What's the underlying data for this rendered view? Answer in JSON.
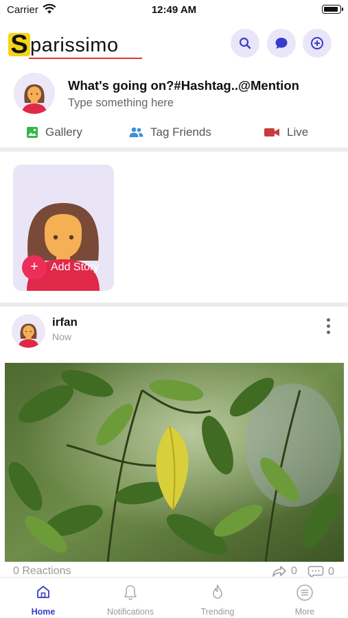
{
  "status_bar": {
    "carrier": "Carrier",
    "time": "12:49 AM"
  },
  "header": {
    "logo_letter": "S",
    "logo_rest": "parissimo",
    "buttons": [
      "search-icon",
      "chat-icon",
      "add-circle-icon"
    ],
    "accent_color": "#3a3ac8"
  },
  "composer": {
    "title": "What's going on?#Hashtag..@Mention",
    "placeholder": "Type something here",
    "actions": [
      {
        "label": "Gallery",
        "icon": "gallery-icon",
        "color": "#3bb54a"
      },
      {
        "label": "Tag Friends",
        "icon": "people-icon",
        "color": "#3d8fd6"
      },
      {
        "label": "Live",
        "icon": "video-camera-icon",
        "color": "#c83c3c"
      }
    ]
  },
  "stories": {
    "add_label": "Add Story",
    "add_symbol": "+"
  },
  "post": {
    "author": "irfan",
    "time": "Now",
    "reactions": "0 Reactions",
    "shares": "0",
    "comments": "0"
  },
  "tabbar": {
    "tabs": [
      {
        "label": "Home",
        "icon": "home-icon",
        "active": true
      },
      {
        "label": "Notifications",
        "icon": "bell-icon",
        "active": false
      },
      {
        "label": "Trending",
        "icon": "flame-icon",
        "active": false
      },
      {
        "label": "More",
        "icon": "menu-icon",
        "active": false
      }
    ]
  }
}
